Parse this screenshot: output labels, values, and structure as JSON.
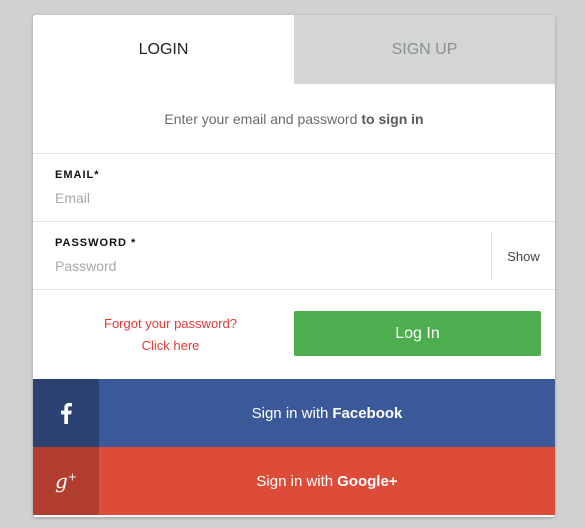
{
  "tabs": {
    "login": "LOGIN",
    "signup": "SIGN UP"
  },
  "intro": {
    "text": "Enter your email and password",
    "emphasis": "to sign in"
  },
  "email": {
    "label": "EMAIL*",
    "placeholder": "Email",
    "value": ""
  },
  "password": {
    "label": "PASSWORD *",
    "placeholder": "Password",
    "value": "",
    "show_label": "Show"
  },
  "forgot": {
    "line1": "Forgot your password?",
    "line2": "Click here"
  },
  "login_button": "Log In",
  "facebook": {
    "prefix": "Sign in with",
    "brand": "Facebook",
    "icon": "facebook-icon"
  },
  "google": {
    "prefix": "Sign in with",
    "brand": "Google+",
    "icon": "google-plus-icon"
  },
  "colors": {
    "login_green": "#4cae4f",
    "facebook_blue": "#3b5998",
    "google_red": "#dd4b39",
    "link_red": "#e53935"
  }
}
